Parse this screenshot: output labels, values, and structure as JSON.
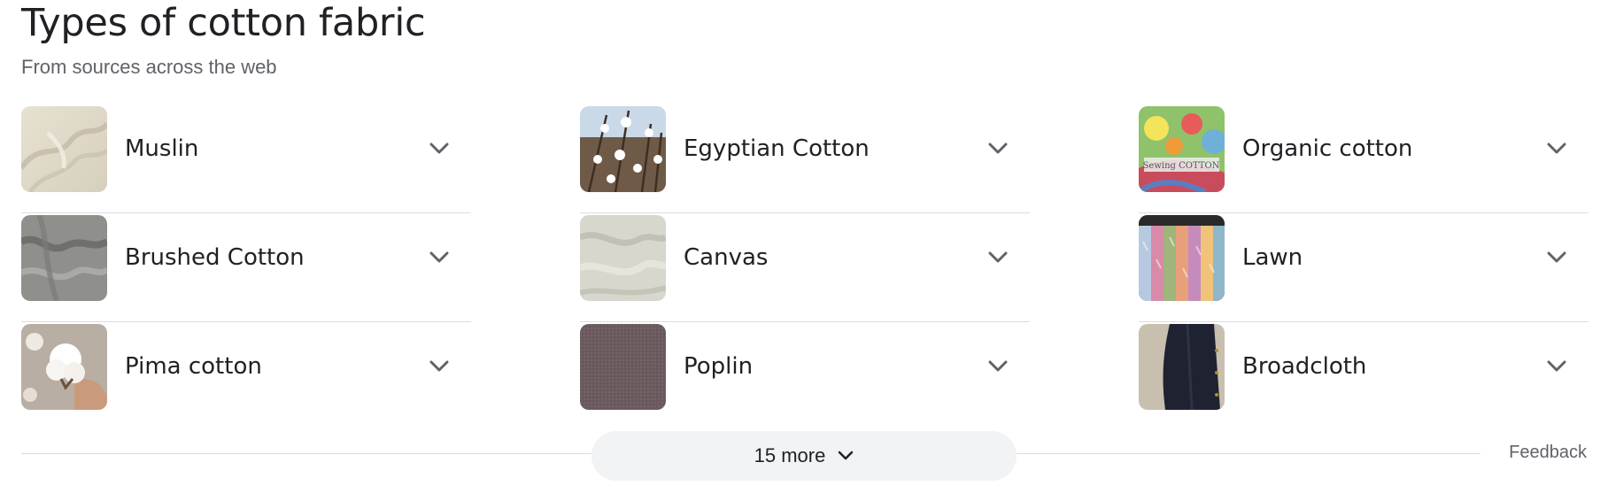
{
  "header": {
    "title": "Types of cotton fabric",
    "subtitle": "From sources across the web"
  },
  "columns": [
    {
      "items": [
        {
          "label": "Muslin",
          "thumb": "muslin-thumbnail"
        },
        {
          "label": "Brushed Cotton",
          "thumb": "brushed-cotton-thumbnail"
        },
        {
          "label": "Pima cotton",
          "thumb": "pima-cotton-thumbnail"
        }
      ]
    },
    {
      "items": [
        {
          "label": "Egyptian Cotton",
          "thumb": "egyptian-cotton-thumbnail"
        },
        {
          "label": "Canvas",
          "thumb": "canvas-thumbnail"
        },
        {
          "label": "Poplin",
          "thumb": "poplin-thumbnail"
        }
      ]
    },
    {
      "items": [
        {
          "label": "Organic cotton",
          "thumb": "organic-cotton-thumbnail",
          "image_text": "Sewing COTTON"
        },
        {
          "label": "Lawn",
          "thumb": "lawn-thumbnail"
        },
        {
          "label": "Broadcloth",
          "thumb": "broadcloth-thumbnail"
        }
      ]
    }
  ],
  "footer": {
    "more_label": "15 more",
    "feedback_label": "Feedback"
  },
  "icons": {
    "expand": "chevron-down-icon"
  },
  "colors": {
    "text": "#202124",
    "secondary": "#5f6368",
    "divider": "#dadce0",
    "button_bg": "#f1f3f4"
  }
}
